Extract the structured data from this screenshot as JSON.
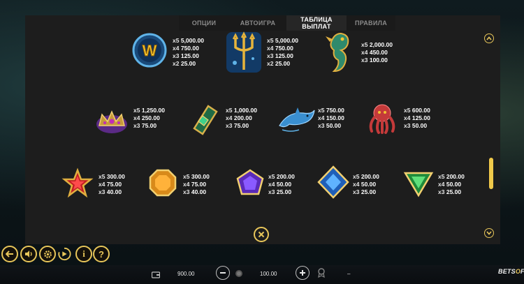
{
  "tabs": [
    {
      "label": "ОПЦИИ"
    },
    {
      "label": "АВТОИГРА"
    },
    {
      "label": "ТАБЛИЦА ВЫПЛАТ"
    },
    {
      "label": "ПРАВИЛА"
    }
  ],
  "active_tab": "ТАБЛИЦА ВЫПЛАТ",
  "paytable": {
    "row1": [
      {
        "icon": "wild-w-icon",
        "pays": [
          {
            "m": "x5",
            "v": "5,000.00"
          },
          {
            "m": "x4",
            "v": "750.00"
          },
          {
            "m": "x3",
            "v": "125.00"
          },
          {
            "m": "x2",
            "v": "25.00"
          }
        ]
      },
      {
        "icon": "trident-icon",
        "pays": [
          {
            "m": "x5",
            "v": "5,000.00"
          },
          {
            "m": "x4",
            "v": "750.00"
          },
          {
            "m": "x3",
            "v": "125.00"
          },
          {
            "m": "x2",
            "v": "25.00"
          }
        ]
      },
      {
        "icon": "seahorse-icon",
        "pays": [
          {
            "m": "x5",
            "v": "2,000.00"
          },
          {
            "m": "x4",
            "v": "450.00"
          },
          {
            "m": "x3",
            "v": "100.00"
          }
        ]
      }
    ],
    "row2": [
      {
        "icon": "crown-icon",
        "pays": [
          {
            "m": "x5",
            "v": "1,250.00"
          },
          {
            "m": "x4",
            "v": "250.00"
          },
          {
            "m": "x3",
            "v": "75.00"
          }
        ]
      },
      {
        "icon": "bracer-icon",
        "pays": [
          {
            "m": "x5",
            "v": "1,000.00"
          },
          {
            "m": "x4",
            "v": "200.00"
          },
          {
            "m": "x3",
            "v": "75.00"
          }
        ]
      },
      {
        "icon": "dolphin-icon",
        "pays": [
          {
            "m": "x5",
            "v": "750.00"
          },
          {
            "m": "x4",
            "v": "150.00"
          },
          {
            "m": "x3",
            "v": "50.00"
          }
        ]
      },
      {
        "icon": "octopus-icon",
        "pays": [
          {
            "m": "x5",
            "v": "600.00"
          },
          {
            "m": "x4",
            "v": "125.00"
          },
          {
            "m": "x3",
            "v": "50.00"
          }
        ]
      }
    ],
    "row3": [
      {
        "icon": "red-star-gem-icon",
        "pays": [
          {
            "m": "x5",
            "v": "300.00"
          },
          {
            "m": "x4",
            "v": "75.00"
          },
          {
            "m": "x3",
            "v": "40.00"
          }
        ]
      },
      {
        "icon": "orange-octagon-gem-icon",
        "pays": [
          {
            "m": "x5",
            "v": "300.00"
          },
          {
            "m": "x4",
            "v": "75.00"
          },
          {
            "m": "x3",
            "v": "40.00"
          }
        ]
      },
      {
        "icon": "purple-pentagon-gem-icon",
        "pays": [
          {
            "m": "x5",
            "v": "200.00"
          },
          {
            "m": "x4",
            "v": "50.00"
          },
          {
            "m": "x3",
            "v": "25.00"
          }
        ]
      },
      {
        "icon": "blue-diamond-gem-icon",
        "pays": [
          {
            "m": "x5",
            "v": "200.00"
          },
          {
            "m": "x4",
            "v": "50.00"
          },
          {
            "m": "x3",
            "v": "25.00"
          }
        ]
      },
      {
        "icon": "green-triangle-gem-icon",
        "pays": [
          {
            "m": "x5",
            "v": "200.00"
          },
          {
            "m": "x4",
            "v": "50.00"
          },
          {
            "m": "x3",
            "v": "25.00"
          }
        ]
      }
    ]
  },
  "bottom_bar": {
    "balance": "900.00",
    "bet": "100.00",
    "win": "–",
    "logo_left": "BETS",
    "logo_o": "O",
    "logo_right": "FT"
  },
  "controls": [
    {
      "icon": "back-icon"
    },
    {
      "icon": "sound-icon"
    },
    {
      "icon": "settings-icon"
    },
    {
      "icon": "autoplay-icon"
    },
    {
      "icon": "info-icon"
    },
    {
      "icon": "help-icon"
    }
  ],
  "colors": {
    "accent": "#e8c65a",
    "panel": "#1d1d1d",
    "multiplier": "#e6e6e6",
    "values": "#ffffff"
  }
}
